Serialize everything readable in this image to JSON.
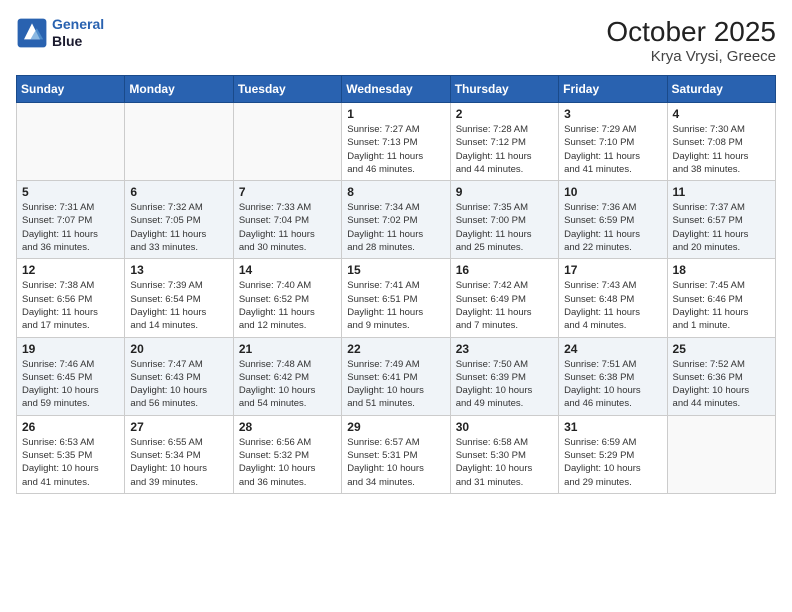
{
  "header": {
    "logo_line1": "General",
    "logo_line2": "Blue",
    "title": "October 2025",
    "subtitle": "Krya Vrysi, Greece"
  },
  "weekdays": [
    "Sunday",
    "Monday",
    "Tuesday",
    "Wednesday",
    "Thursday",
    "Friday",
    "Saturday"
  ],
  "weeks": [
    [
      {
        "day": "",
        "info": ""
      },
      {
        "day": "",
        "info": ""
      },
      {
        "day": "",
        "info": ""
      },
      {
        "day": "1",
        "info": "Sunrise: 7:27 AM\nSunset: 7:13 PM\nDaylight: 11 hours\nand 46 minutes."
      },
      {
        "day": "2",
        "info": "Sunrise: 7:28 AM\nSunset: 7:12 PM\nDaylight: 11 hours\nand 44 minutes."
      },
      {
        "day": "3",
        "info": "Sunrise: 7:29 AM\nSunset: 7:10 PM\nDaylight: 11 hours\nand 41 minutes."
      },
      {
        "day": "4",
        "info": "Sunrise: 7:30 AM\nSunset: 7:08 PM\nDaylight: 11 hours\nand 38 minutes."
      }
    ],
    [
      {
        "day": "5",
        "info": "Sunrise: 7:31 AM\nSunset: 7:07 PM\nDaylight: 11 hours\nand 36 minutes."
      },
      {
        "day": "6",
        "info": "Sunrise: 7:32 AM\nSunset: 7:05 PM\nDaylight: 11 hours\nand 33 minutes."
      },
      {
        "day": "7",
        "info": "Sunrise: 7:33 AM\nSunset: 7:04 PM\nDaylight: 11 hours\nand 30 minutes."
      },
      {
        "day": "8",
        "info": "Sunrise: 7:34 AM\nSunset: 7:02 PM\nDaylight: 11 hours\nand 28 minutes."
      },
      {
        "day": "9",
        "info": "Sunrise: 7:35 AM\nSunset: 7:00 PM\nDaylight: 11 hours\nand 25 minutes."
      },
      {
        "day": "10",
        "info": "Sunrise: 7:36 AM\nSunset: 6:59 PM\nDaylight: 11 hours\nand 22 minutes."
      },
      {
        "day": "11",
        "info": "Sunrise: 7:37 AM\nSunset: 6:57 PM\nDaylight: 11 hours\nand 20 minutes."
      }
    ],
    [
      {
        "day": "12",
        "info": "Sunrise: 7:38 AM\nSunset: 6:56 PM\nDaylight: 11 hours\nand 17 minutes."
      },
      {
        "day": "13",
        "info": "Sunrise: 7:39 AM\nSunset: 6:54 PM\nDaylight: 11 hours\nand 14 minutes."
      },
      {
        "day": "14",
        "info": "Sunrise: 7:40 AM\nSunset: 6:52 PM\nDaylight: 11 hours\nand 12 minutes."
      },
      {
        "day": "15",
        "info": "Sunrise: 7:41 AM\nSunset: 6:51 PM\nDaylight: 11 hours\nand 9 minutes."
      },
      {
        "day": "16",
        "info": "Sunrise: 7:42 AM\nSunset: 6:49 PM\nDaylight: 11 hours\nand 7 minutes."
      },
      {
        "day": "17",
        "info": "Sunrise: 7:43 AM\nSunset: 6:48 PM\nDaylight: 11 hours\nand 4 minutes."
      },
      {
        "day": "18",
        "info": "Sunrise: 7:45 AM\nSunset: 6:46 PM\nDaylight: 11 hours\nand 1 minute."
      }
    ],
    [
      {
        "day": "19",
        "info": "Sunrise: 7:46 AM\nSunset: 6:45 PM\nDaylight: 10 hours\nand 59 minutes."
      },
      {
        "day": "20",
        "info": "Sunrise: 7:47 AM\nSunset: 6:43 PM\nDaylight: 10 hours\nand 56 minutes."
      },
      {
        "day": "21",
        "info": "Sunrise: 7:48 AM\nSunset: 6:42 PM\nDaylight: 10 hours\nand 54 minutes."
      },
      {
        "day": "22",
        "info": "Sunrise: 7:49 AM\nSunset: 6:41 PM\nDaylight: 10 hours\nand 51 minutes."
      },
      {
        "day": "23",
        "info": "Sunrise: 7:50 AM\nSunset: 6:39 PM\nDaylight: 10 hours\nand 49 minutes."
      },
      {
        "day": "24",
        "info": "Sunrise: 7:51 AM\nSunset: 6:38 PM\nDaylight: 10 hours\nand 46 minutes."
      },
      {
        "day": "25",
        "info": "Sunrise: 7:52 AM\nSunset: 6:36 PM\nDaylight: 10 hours\nand 44 minutes."
      }
    ],
    [
      {
        "day": "26",
        "info": "Sunrise: 6:53 AM\nSunset: 5:35 PM\nDaylight: 10 hours\nand 41 minutes."
      },
      {
        "day": "27",
        "info": "Sunrise: 6:55 AM\nSunset: 5:34 PM\nDaylight: 10 hours\nand 39 minutes."
      },
      {
        "day": "28",
        "info": "Sunrise: 6:56 AM\nSunset: 5:32 PM\nDaylight: 10 hours\nand 36 minutes."
      },
      {
        "day": "29",
        "info": "Sunrise: 6:57 AM\nSunset: 5:31 PM\nDaylight: 10 hours\nand 34 minutes."
      },
      {
        "day": "30",
        "info": "Sunrise: 6:58 AM\nSunset: 5:30 PM\nDaylight: 10 hours\nand 31 minutes."
      },
      {
        "day": "31",
        "info": "Sunrise: 6:59 AM\nSunset: 5:29 PM\nDaylight: 10 hours\nand 29 minutes."
      },
      {
        "day": "",
        "info": ""
      }
    ]
  ]
}
